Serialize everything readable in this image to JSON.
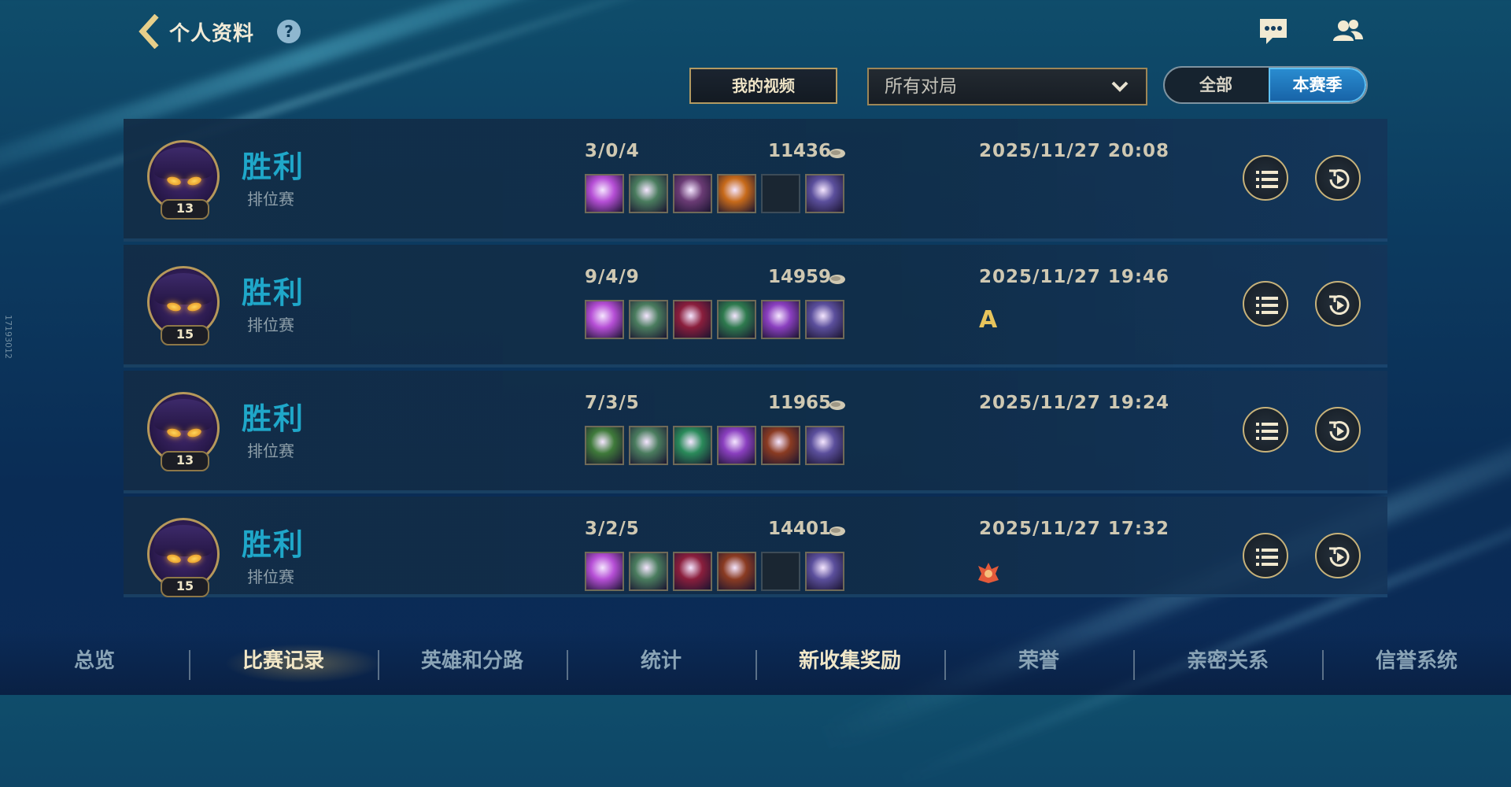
{
  "header": {
    "title": "个人资料",
    "help_label": "?"
  },
  "filters": {
    "video_button": "我的视频",
    "match_type": "所有对局",
    "season_options": [
      "全部",
      "本赛季"
    ],
    "season_selected": "本赛季"
  },
  "matches": [
    {
      "level": "13",
      "result": "胜利",
      "mode": "排位赛",
      "kda": "3/0/4",
      "gold": "11436",
      "time": "2025/11/27 20:08",
      "grade": "",
      "items": [
        "#b64fd6",
        "#4a7c5e",
        "#6a3b74",
        "#c76a1a",
        "empty",
        "#5b4f9c"
      ]
    },
    {
      "level": "15",
      "result": "胜利",
      "mode": "排位赛",
      "kda": "9/4/9",
      "gold": "14959",
      "time": "2025/11/27 19:46",
      "grade": "A",
      "items": [
        "#b64fd6",
        "#4a7c5e",
        "#8a1e3c",
        "#2e7a4e",
        "#8a3fbf",
        "#5b4f9c"
      ]
    },
    {
      "level": "13",
      "result": "胜利",
      "mode": "排位赛",
      "kda": "7/3/5",
      "gold": "11965",
      "time": "2025/11/27 19:24",
      "grade": "",
      "items": [
        "#3f7a3a",
        "#4a7c5e",
        "#2a8a5a",
        "#8a3fbf",
        "#8a3b22",
        "#5b4f9c"
      ]
    },
    {
      "level": "15",
      "result": "胜利",
      "mode": "排位赛",
      "kda": "3/2/5",
      "gold": "14401",
      "time": "2025/11/27 17:32",
      "grade": "",
      "mvp": true,
      "items": [
        "#b64fd6",
        "#4a7c5e",
        "#8a1e3c",
        "#8a3b22",
        "empty",
        "#5b4f9c"
      ]
    }
  ],
  "nav": {
    "tabs": [
      "总览",
      "比赛记录",
      "英雄和分路",
      "统计",
      "新收集奖励",
      "荣誉",
      "亲密关系",
      "信誉系统"
    ],
    "active": "比赛记录"
  },
  "side_id": "17193012",
  "colors": {
    "accent": "#1fa7c9",
    "gold_border": "#b39a62",
    "selected_seg": "#1f78bd"
  },
  "icons": {
    "back": "chevron-left-icon",
    "help": "question-icon",
    "chat": "chat-icon",
    "friends": "friends-icon",
    "detail": "list-icon",
    "replay": "replay-icon",
    "gold": "gold-coin-icon",
    "dropdown": "chevron-down-icon"
  }
}
